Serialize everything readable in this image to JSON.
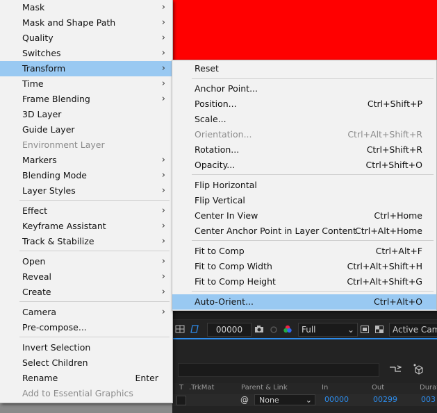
{
  "main_menu": {
    "items": [
      {
        "label": "Mask",
        "submenu": true
      },
      {
        "label": "Mask and Shape Path",
        "submenu": true
      },
      {
        "label": "Quality",
        "submenu": true
      },
      {
        "label": "Switches",
        "submenu": true
      },
      {
        "label": "Transform",
        "submenu": true
      },
      {
        "label": "Time",
        "submenu": true
      },
      {
        "label": "Frame Blending",
        "submenu": true
      },
      {
        "label": "3D Layer"
      },
      {
        "label": "Guide Layer"
      },
      {
        "label": "Environment Layer"
      },
      {
        "label": "Markers",
        "submenu": true
      },
      {
        "label": "Blending Mode",
        "submenu": true
      },
      {
        "label": "Layer Styles",
        "submenu": true
      },
      {
        "label": "Effect",
        "submenu": true
      },
      {
        "label": "Keyframe Assistant",
        "submenu": true
      },
      {
        "label": "Track & Stabilize",
        "submenu": true
      },
      {
        "label": "Open",
        "submenu": true
      },
      {
        "label": "Reveal",
        "submenu": true
      },
      {
        "label": "Create",
        "submenu": true
      },
      {
        "label": "Camera",
        "submenu": true
      },
      {
        "label": "Pre-compose..."
      },
      {
        "label": "Invert Selection"
      },
      {
        "label": "Select Children"
      },
      {
        "label": "Rename",
        "shortcut": "Enter"
      },
      {
        "label": "Add to Essential Graphics"
      }
    ],
    "arrow_glyph": "›"
  },
  "transform_submenu": {
    "items": [
      {
        "label": "Reset",
        "shortcut": ""
      },
      {
        "label": "Anchor Point...",
        "shortcut": ""
      },
      {
        "label": "Position...",
        "shortcut": "Ctrl+Shift+P"
      },
      {
        "label": "Scale...",
        "shortcut": ""
      },
      {
        "label": "Orientation...",
        "shortcut": "Ctrl+Alt+Shift+R"
      },
      {
        "label": "Rotation...",
        "shortcut": "Ctrl+Shift+R"
      },
      {
        "label": "Opacity...",
        "shortcut": "Ctrl+Shift+O"
      },
      {
        "label": "Flip Horizontal",
        "shortcut": ""
      },
      {
        "label": "Flip Vertical",
        "shortcut": ""
      },
      {
        "label": "Center In View",
        "shortcut": "Ctrl+Home"
      },
      {
        "label": "Center Anchor Point in Layer Content",
        "shortcut": "Ctrl+Alt+Home"
      },
      {
        "label": "Fit to Comp",
        "shortcut": "Ctrl+Alt+F"
      },
      {
        "label": "Fit to Comp Width",
        "shortcut": "Ctrl+Alt+Shift+H"
      },
      {
        "label": "Fit to Comp Height",
        "shortcut": "Ctrl+Alt+Shift+G"
      },
      {
        "label": "Auto-Orient...",
        "shortcut": "Ctrl+Alt+O"
      }
    ]
  },
  "viewer_toolbar": {
    "timecode": "00000",
    "resolution": "Full",
    "view": "Active Came"
  },
  "timeline": {
    "columns": {
      "t": "T",
      "trkmat": ".TrkMat",
      "parent": "Parent & Link",
      "in": "In",
      "out": "Out",
      "duration": "Durati"
    },
    "row": {
      "parent_value": "None",
      "in": "00000",
      "out": "00299",
      "duration": "003"
    }
  },
  "colors": {
    "highlight": "#99c9f2",
    "comp_bg": "#ff0000",
    "accent": "#2d8ceb"
  }
}
